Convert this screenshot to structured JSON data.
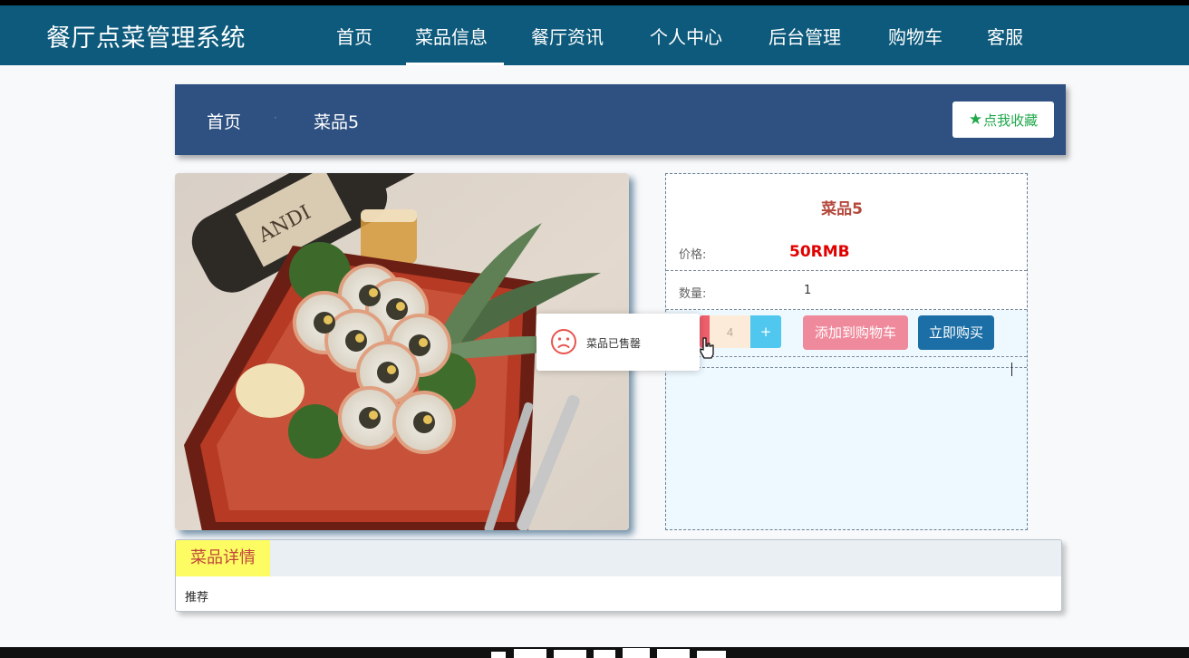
{
  "app": {
    "title": "餐厅点菜管理系统"
  },
  "nav": {
    "items": [
      {
        "label": "首页"
      },
      {
        "label": "菜品信息"
      },
      {
        "label": "餐厅资讯"
      },
      {
        "label": "个人中心"
      },
      {
        "label": "后台管理"
      },
      {
        "label": "购物车"
      },
      {
        "label": "客服"
      }
    ],
    "active": "菜品信息"
  },
  "breadcrumb": {
    "home": "首页",
    "separator": "·",
    "current": "菜品5"
  },
  "favorite": {
    "label": "点我收藏",
    "icon": "star-icon"
  },
  "product": {
    "name": "菜品5",
    "price_label": "价格:",
    "price": "50RMB",
    "quantity_label": "数量:",
    "quantity": "1",
    "stepper_value": "4",
    "stepper_plus": "+",
    "add_to_cart": "添加到购物车",
    "buy_now": "立即购买"
  },
  "toast": {
    "message": "菜品已售罄",
    "icon": "sad-face-icon"
  },
  "details": {
    "tab": "菜品详情",
    "content": "推荐"
  },
  "colors": {
    "nav_bg": "#0d5a7c",
    "breadcrumb_bg": "#2e5181",
    "price": "#e00000",
    "add_cart": "#ef8a9c",
    "buy_now": "#1c6fa6",
    "details_tab": "#fdfc63"
  }
}
